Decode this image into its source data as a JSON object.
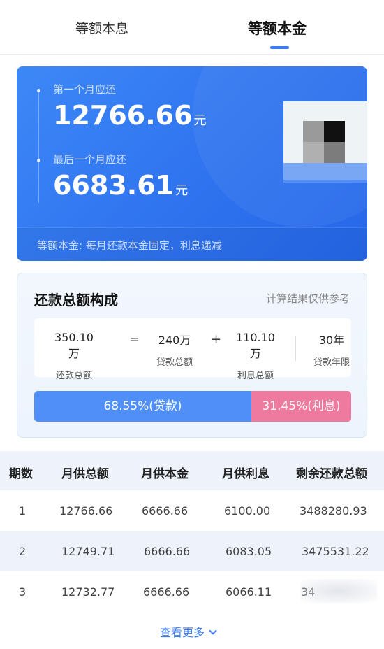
{
  "tabs": [
    {
      "label": "等额本息"
    },
    {
      "label": "等额本金"
    }
  ],
  "hero": {
    "first_label": "第一个月应还",
    "first_amount": "12766.66",
    "last_label": "最后一个月应还",
    "last_amount": "6683.61",
    "unit": "元",
    "note": "等额本金: 每月还款本金固定，利息递减"
  },
  "summary": {
    "title": "还款总额构成",
    "note": "计算结果仅供参考",
    "total_value": "350.10万",
    "total_label": "还款总额",
    "equals": "=",
    "loan_value": "240万",
    "loan_label": "贷款总额",
    "plus": "+",
    "interest_value": "110.10万",
    "interest_label": "利息总额",
    "years_value": "30年",
    "years_label": "贷款年限",
    "loan_share": 0.6855,
    "loan_share_text": "68.55%(贷款)",
    "interest_share": 0.3145,
    "interest_share_text": "31.45%(利息)",
    "colors": {
      "loan": "#4f8ff7",
      "interest": "#ee7aa0"
    }
  },
  "table": {
    "headers": [
      "期数",
      "月供总额",
      "月供本金",
      "月供利息",
      "剩余还款总额"
    ],
    "rows": [
      [
        "1",
        "12766.66",
        "6666.66",
        "6100.00",
        "3488280.93"
      ],
      [
        "2",
        "12749.71",
        "6666.66",
        "6083.05",
        "3475531.22"
      ],
      [
        "3",
        "12732.77",
        "6666.66",
        "6066.11",
        "34"
      ]
    ]
  },
  "more": {
    "label": "查看更多",
    "icon": "chevron-down-icon"
  },
  "colors": {
    "accent": "#3b7cf6",
    "hero": "#2f73ef"
  }
}
